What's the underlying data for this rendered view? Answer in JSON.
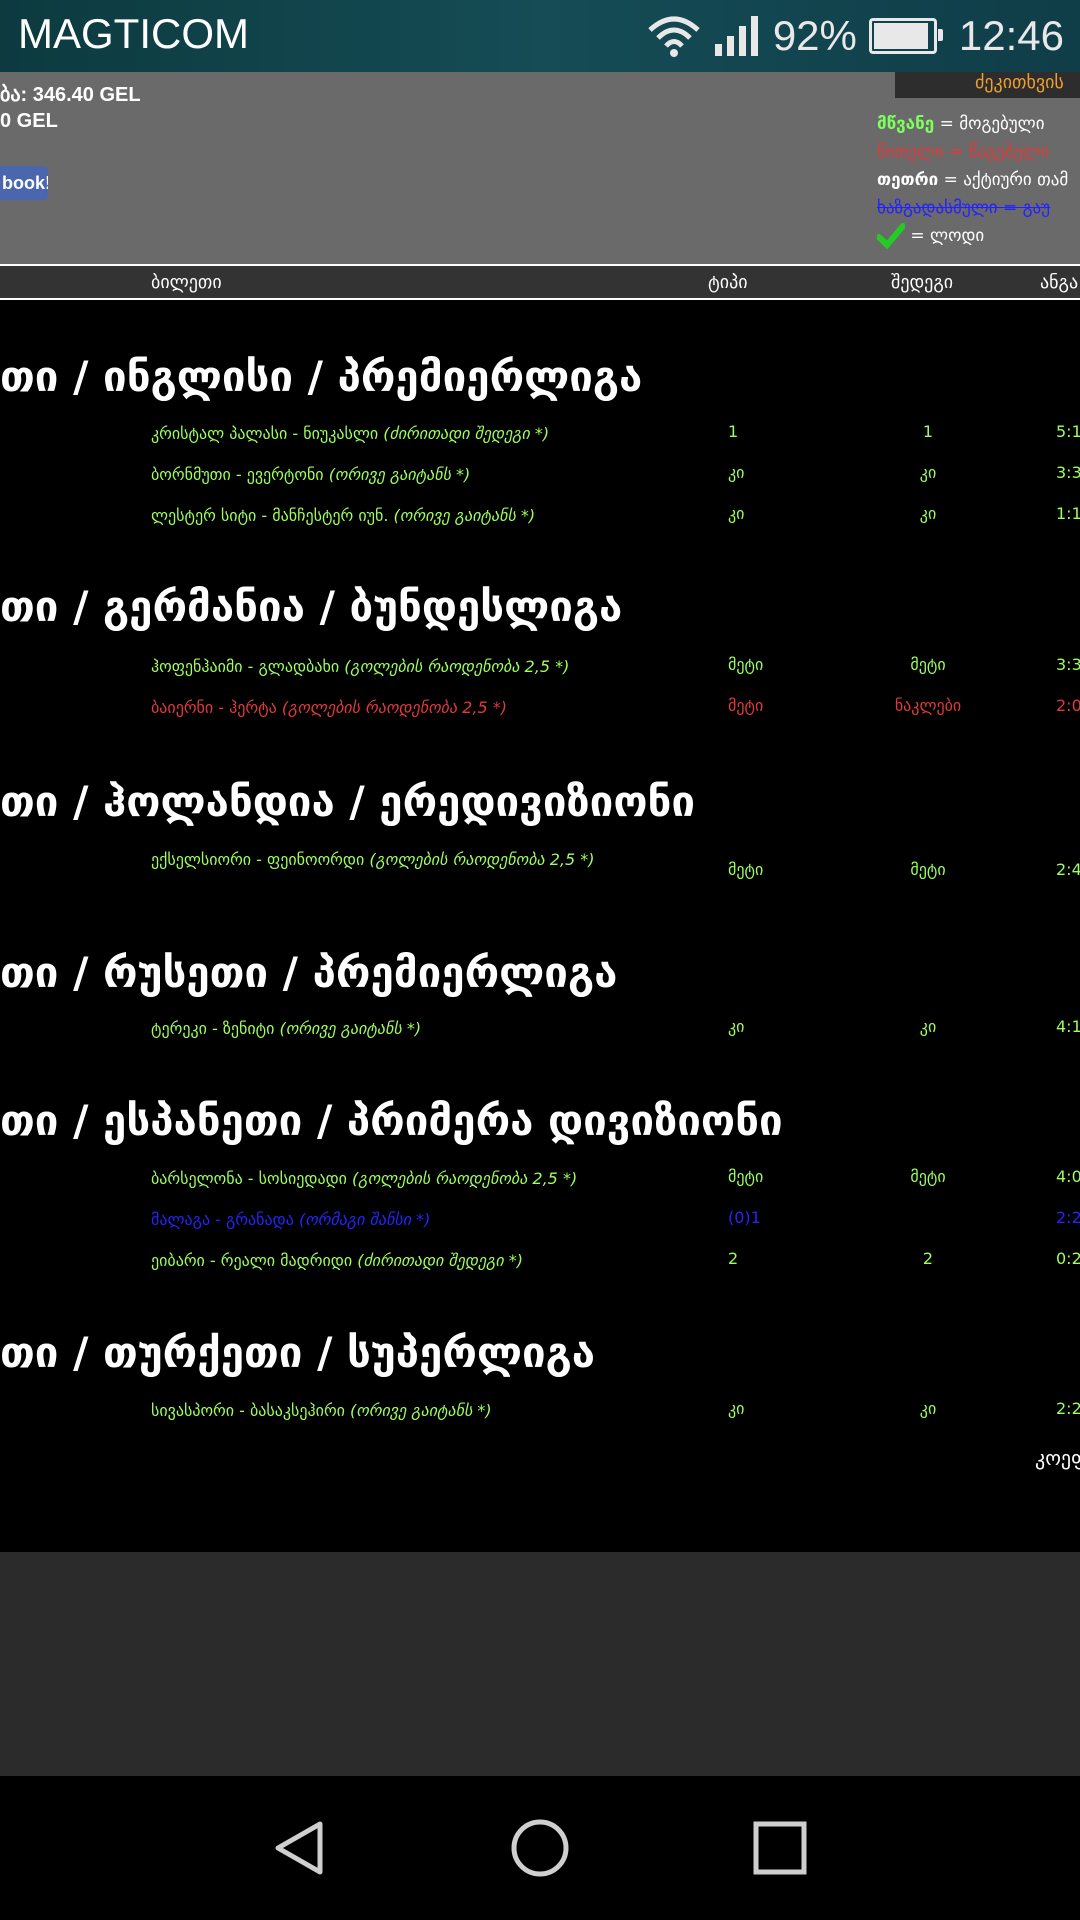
{
  "status_bar": {
    "carrier": "MAGTICOM",
    "battery_pct": "92%",
    "battery_level": 0.92,
    "time": "12:46"
  },
  "top_panel": {
    "line1": "ბა: 346.40 GEL",
    "line2": "0 GEL",
    "facebook_label": "book!",
    "dark_button_label": "ძეკითხვის"
  },
  "legend": {
    "green_word": "მწვანე",
    "green_meaning": " = მოგებული",
    "red_text": "წითელი = წაგებული",
    "white_word": "თეთრი",
    "white_meaning": " = აქტიური თამ",
    "blue_text": "ხაზგადასმული = გაუ",
    "check_meaning": "= ლოდი"
  },
  "table_header": {
    "ticket": "ბილეთი",
    "type": "ტიპი",
    "result": "შედეგი",
    "score": "ანგა"
  },
  "leagues": [
    {
      "title": "თი / ინგლისი / პრემიერლიგა",
      "matches": [
        {
          "name": "კრისტალ პალასი - ნიუკასლი",
          "tag": "(ძირითადი შედეგი *)",
          "tip": "1",
          "result": "1",
          "score": "5:1"
        },
        {
          "name": "ბორნმუთი - ევერტონი",
          "tag": "(ორივე გაიტანს *)",
          "tip": "კი",
          "result": "კი",
          "score": "3:3"
        },
        {
          "name": "ლესტერ სიტი - მანჩესტერ იუნ.",
          "tag": "(ორივე გაიტანს *)",
          "tip": "კი",
          "result": "კი",
          "score": "1:1"
        }
      ]
    },
    {
      "title": "თი / გერმანია / ბუნდესლიგა",
      "matches": [
        {
          "name": "ჰოფენჰაიმი - გლადბახი",
          "tag": "(გოლების რაოდენობა 2,5 *)",
          "tip": "მეტი",
          "result": "მეტი",
          "score": "3:3"
        },
        {
          "name": "ბაიერნი - ჰერტა",
          "tag": "(გოლების რაოდენობა 2,5 *)",
          "tip": "მეტი",
          "result": "ნაკლები",
          "score": "2:0"
        }
      ]
    },
    {
      "title": "თი / ჰოლანდია / ერედივიზიონი",
      "matches": [
        {
          "name": "ექსელსიორი - ფეინოორდი",
          "tag": "(გოლების რაოდენობა 2,5 *)",
          "tip": "მეტი",
          "result": "მეტი",
          "score": "2:4"
        }
      ]
    },
    {
      "title": "თი / რუსეთი / პრემიერლიგა",
      "matches": [
        {
          "name": "ტერეკი - ზენიტი",
          "tag": "(ორივე გაიტანს *)",
          "tip": "კი",
          "result": "კი",
          "score": "4:1"
        }
      ]
    },
    {
      "title": "თი / ესპანეთი / პრიმერა დივიზიონი",
      "matches": [
        {
          "name": "ბარსელონა - სოსიედადი",
          "tag": "(გოლების რაოდენობა 2,5 *)",
          "tip": "მეტი",
          "result": "მეტი",
          "score": "4:0"
        },
        {
          "name": "მალაგა - გრანადა",
          "tag": "(ორმაგი შანსი *)",
          "tip": "(0)1",
          "result": "",
          "score": "2:2"
        },
        {
          "name": "ეიბარი - რეალი მადრიდი",
          "tag": "(ძირითადი შედეგი *)",
          "tip": "2",
          "result": "2",
          "score": "0:2"
        }
      ]
    },
    {
      "title": "თი / თურქეთი / სუპერლიგა",
      "matches": [
        {
          "name": "სივასპორი - ბასაკსეჰირი",
          "tag": "(ორივე გაიტანს *)",
          "tip": "კი",
          "result": "კი",
          "score": "2:2"
        }
      ]
    }
  ],
  "tail_text": "კოეფ",
  "colors": {
    "green": "#9cff5e",
    "red": "#e03a3a",
    "blue": "#2424ff",
    "status_bar": "#154c55",
    "panel": "#6a6a6a"
  },
  "nav": {
    "back": "back-icon",
    "home": "home-icon",
    "recents": "recents-icon"
  }
}
